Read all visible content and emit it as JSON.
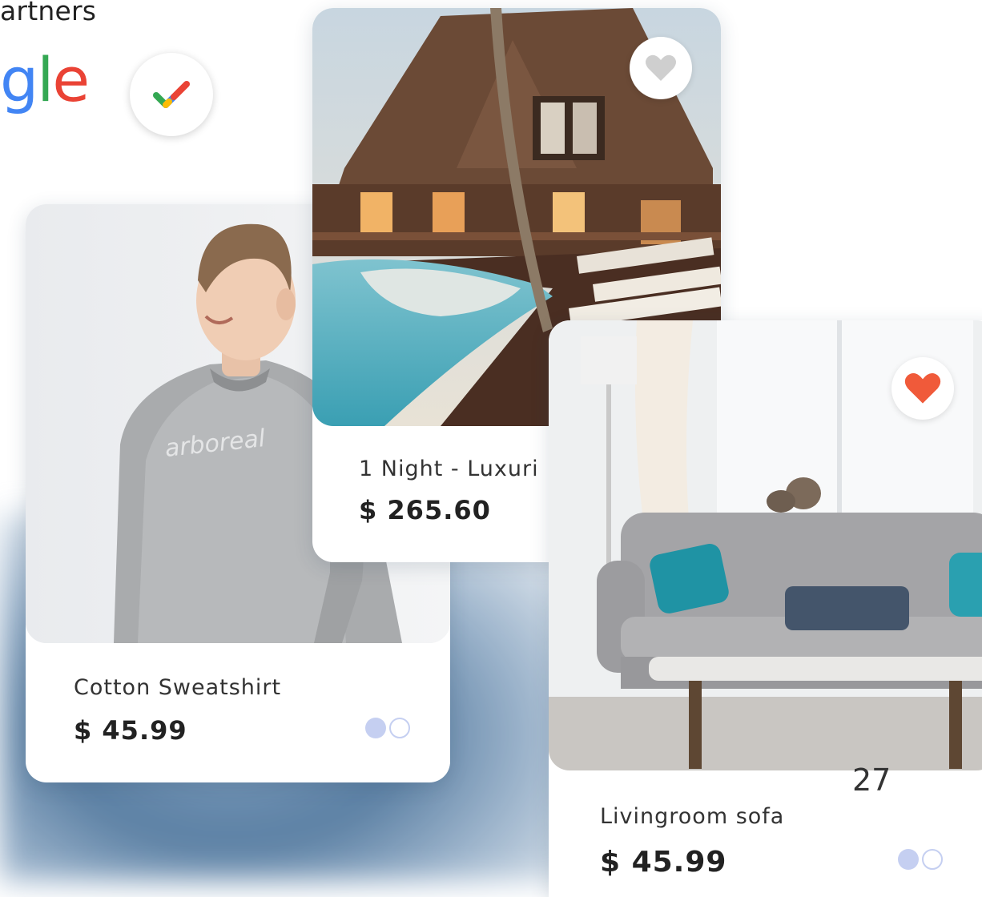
{
  "header": {
    "partners_text": "artners",
    "google_partial": {
      "part1": "g",
      "part2": "l",
      "part3": "e"
    }
  },
  "cards": {
    "sweatshirt": {
      "title": "Cotton Sweatshirt",
      "price": "$ 45.99",
      "shirt_print": "arboreal",
      "carousel_dots": 2,
      "active_dot": 1
    },
    "hotel": {
      "title": "1 Night - Luxuri",
      "price": "$ 265.60",
      "favorited": false
    },
    "sofa": {
      "title": "Livingroom sofa",
      "price": "$ 45.99",
      "favorited": true,
      "carousel_dots": 2,
      "active_dot": 1
    }
  },
  "page_number": "27",
  "colors": {
    "accent_dot": "#c5cff1",
    "heart_active": "#f05a3a",
    "heart_inactive": "#cfcfcf",
    "google_blue": "#4285F4",
    "google_green": "#34A853",
    "google_red": "#EA4335"
  }
}
